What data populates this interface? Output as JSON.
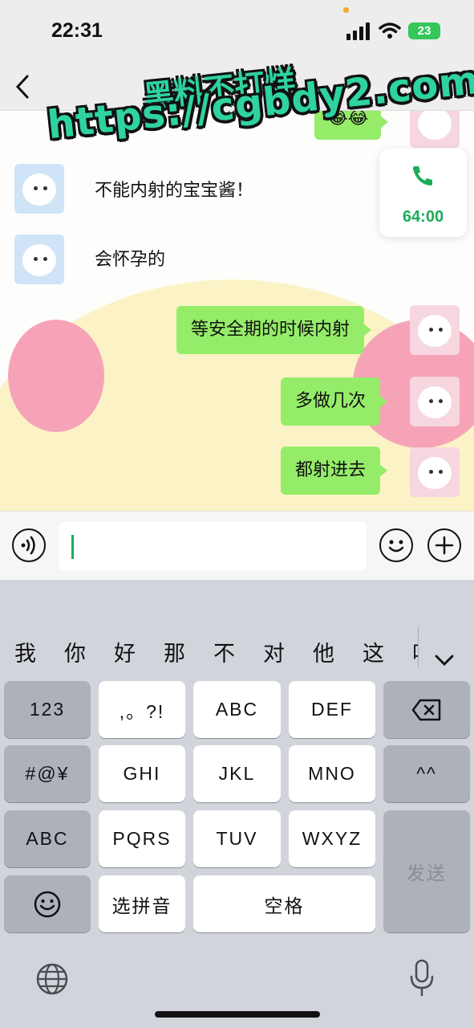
{
  "status_bar": {
    "time": "22:31",
    "battery": "23"
  },
  "header": {
    "back": "‹",
    "more": "·"
  },
  "watermark": {
    "line1": "黑料不打烊",
    "line2": "https://cgbdy2.com"
  },
  "messages": [
    {
      "side": "left",
      "text": "不能内射的宝宝酱！"
    },
    {
      "side": "left",
      "text": "会怀孕的"
    },
    {
      "side": "right",
      "text": "等安全期的时候内射"
    },
    {
      "side": "right",
      "text": "多做几次"
    },
    {
      "side": "right",
      "text": "都射进去"
    }
  ],
  "partial_top_bubble": "😂😂",
  "call_card": {
    "duration": "64:00"
  },
  "candidates": [
    "我",
    "你",
    "好",
    "那",
    "不",
    "对",
    "他",
    "这",
    "吧"
  ],
  "keyboard": {
    "k123": "123",
    "punct": ",。?!",
    "abc": "ABC",
    "def": "DEF",
    "hash": "#@¥",
    "ghi": "GHI",
    "jkl": "JKL",
    "mno": "MNO",
    "face": "^^",
    "abc_mode": "ABC",
    "pqrs": "PQRS",
    "tuv": "TUV",
    "wxyz": "WXYZ",
    "send": "发送",
    "pinyin": "选拼音",
    "space": "空格"
  }
}
